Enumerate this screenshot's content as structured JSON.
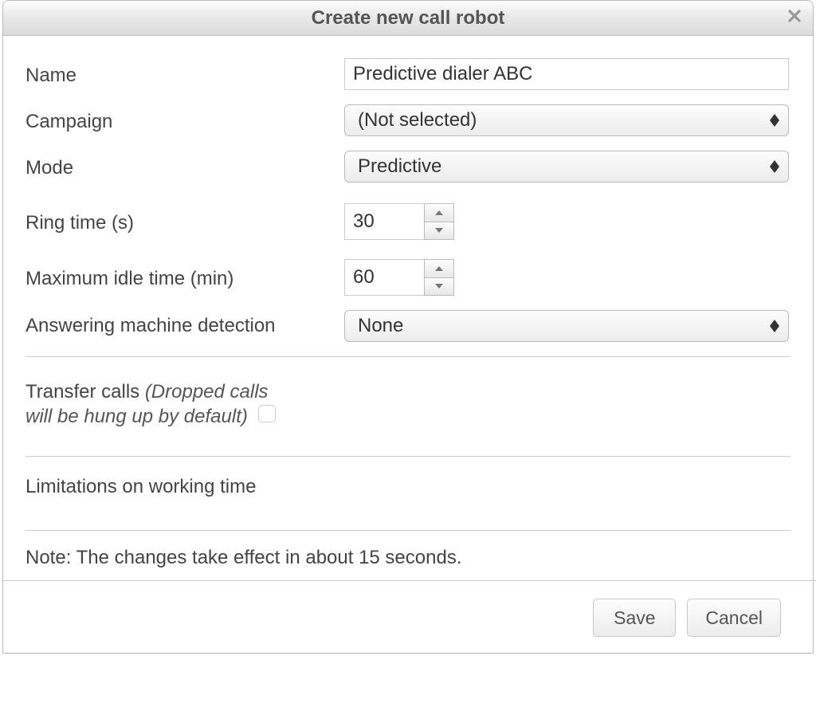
{
  "dialog": {
    "title": "Create new call robot"
  },
  "form": {
    "name_label": "Name",
    "name_value": "Predictive dialer ABC",
    "campaign_label": "Campaign",
    "campaign_value": "(Not selected)",
    "mode_label": "Mode",
    "mode_value": "Predictive",
    "ring_time_label": "Ring time (s)",
    "ring_time_value": "30",
    "max_idle_label": "Maximum idle time (min)",
    "max_idle_value": "60",
    "amd_label": "Answering machine detection",
    "amd_value": "None",
    "transfer_label_main": "Transfer calls ",
    "transfer_label_note": "(Dropped calls will be hung up by default)",
    "limitations_heading": "Limitations on working time",
    "note": "Note: The changes take effect in about 15 seconds."
  },
  "buttons": {
    "save": "Save",
    "cancel": "Cancel"
  }
}
